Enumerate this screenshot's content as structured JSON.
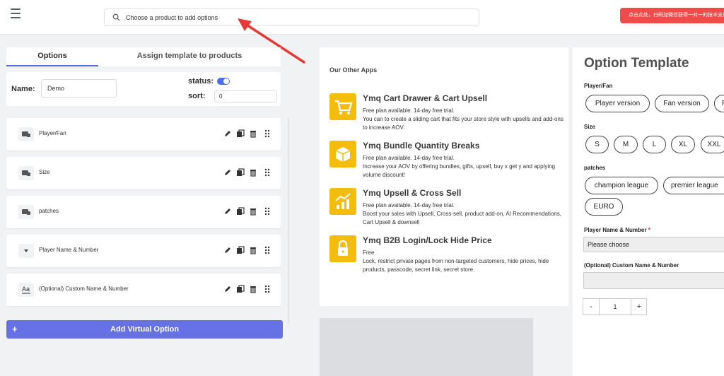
{
  "header": {
    "search": {
      "placeholder": "Choose a product to add options"
    },
    "banner_text": "点击此处，扫码加微信获得一对一的技术支持"
  },
  "tabs": [
    {
      "label": "Options",
      "active": true
    },
    {
      "label": "Assign template to products",
      "active": false
    }
  ],
  "form": {
    "name_label": "Name:",
    "name_value": "Demo",
    "status_label": "status:",
    "status_on": true,
    "sort_label": "sort:",
    "sort_value": "0"
  },
  "options": [
    {
      "label": "Player/Fan",
      "icon": "swatch-icon"
    },
    {
      "label": "Size",
      "icon": "swatch-icon"
    },
    {
      "label": "patches",
      "icon": "swatch-icon"
    },
    {
      "label": "Player Name & Number",
      "icon": "dropdown-icon"
    },
    {
      "label": "(Optional) Custom Name & Number",
      "icon": "text-field-icon"
    }
  ],
  "add_button": {
    "plus": "+",
    "label": "Add Virtual Option"
  },
  "other_apps": {
    "title": "Our Other Apps",
    "apps": [
      {
        "title": "Ymq Cart Drawer & Cart Upsell",
        "desc1": "Free plan available. 14-day free trial.",
        "desc2": "You can to create a sliding cart that fits your store style with upsells and add-ons to increase AOV.",
        "icon": "cart-icon"
      },
      {
        "title": "Ymq Bundle Quantity Breaks",
        "desc1": "Free plan available. 14-day free trial.",
        "desc2": "Increase your AOV by offering bundles, gifts, upsell, buy x get y and applying volume discount!",
        "icon": "box-icon"
      },
      {
        "title": "Ymq Upsell & Cross Sell",
        "desc1": "Free plan available. 14-day free trial.",
        "desc2": "Boost your sales with Upsell, Cross-sell, product add-on, AI Recommendations, Cart Upsell & downsell",
        "icon": "growth-chart-icon"
      },
      {
        "title": "Ymq B2B Login/Lock Hide Price",
        "desc1": "Free",
        "desc2": "Lock, restrict private pages from non-targeted customers, hide prices, hide products, passcode, secret link, secret store.",
        "icon": "lock-icon"
      }
    ]
  },
  "template": {
    "title": "Option Template",
    "player_fan": {
      "label": "Player/Fan",
      "values": [
        "Player version",
        "Fan version",
        "F"
      ]
    },
    "size": {
      "label": "Size",
      "values": [
        "S",
        "M",
        "L",
        "XL",
        "XXL"
      ]
    },
    "patches": {
      "label": "patches",
      "values": [
        "champion league",
        "premier league",
        "EURO"
      ]
    },
    "player_name": {
      "label": "Player Name & Number",
      "required_mark": "*",
      "selected": "Please choose"
    },
    "custom_name": {
      "label": "(Optional) Custom Name & Number"
    },
    "quantity": {
      "minus": "-",
      "value": "1",
      "plus": "+"
    }
  },
  "colors": {
    "accent": "#6671e6",
    "banner": "#ef4b4b",
    "app_icon": "#f5bd0b"
  }
}
